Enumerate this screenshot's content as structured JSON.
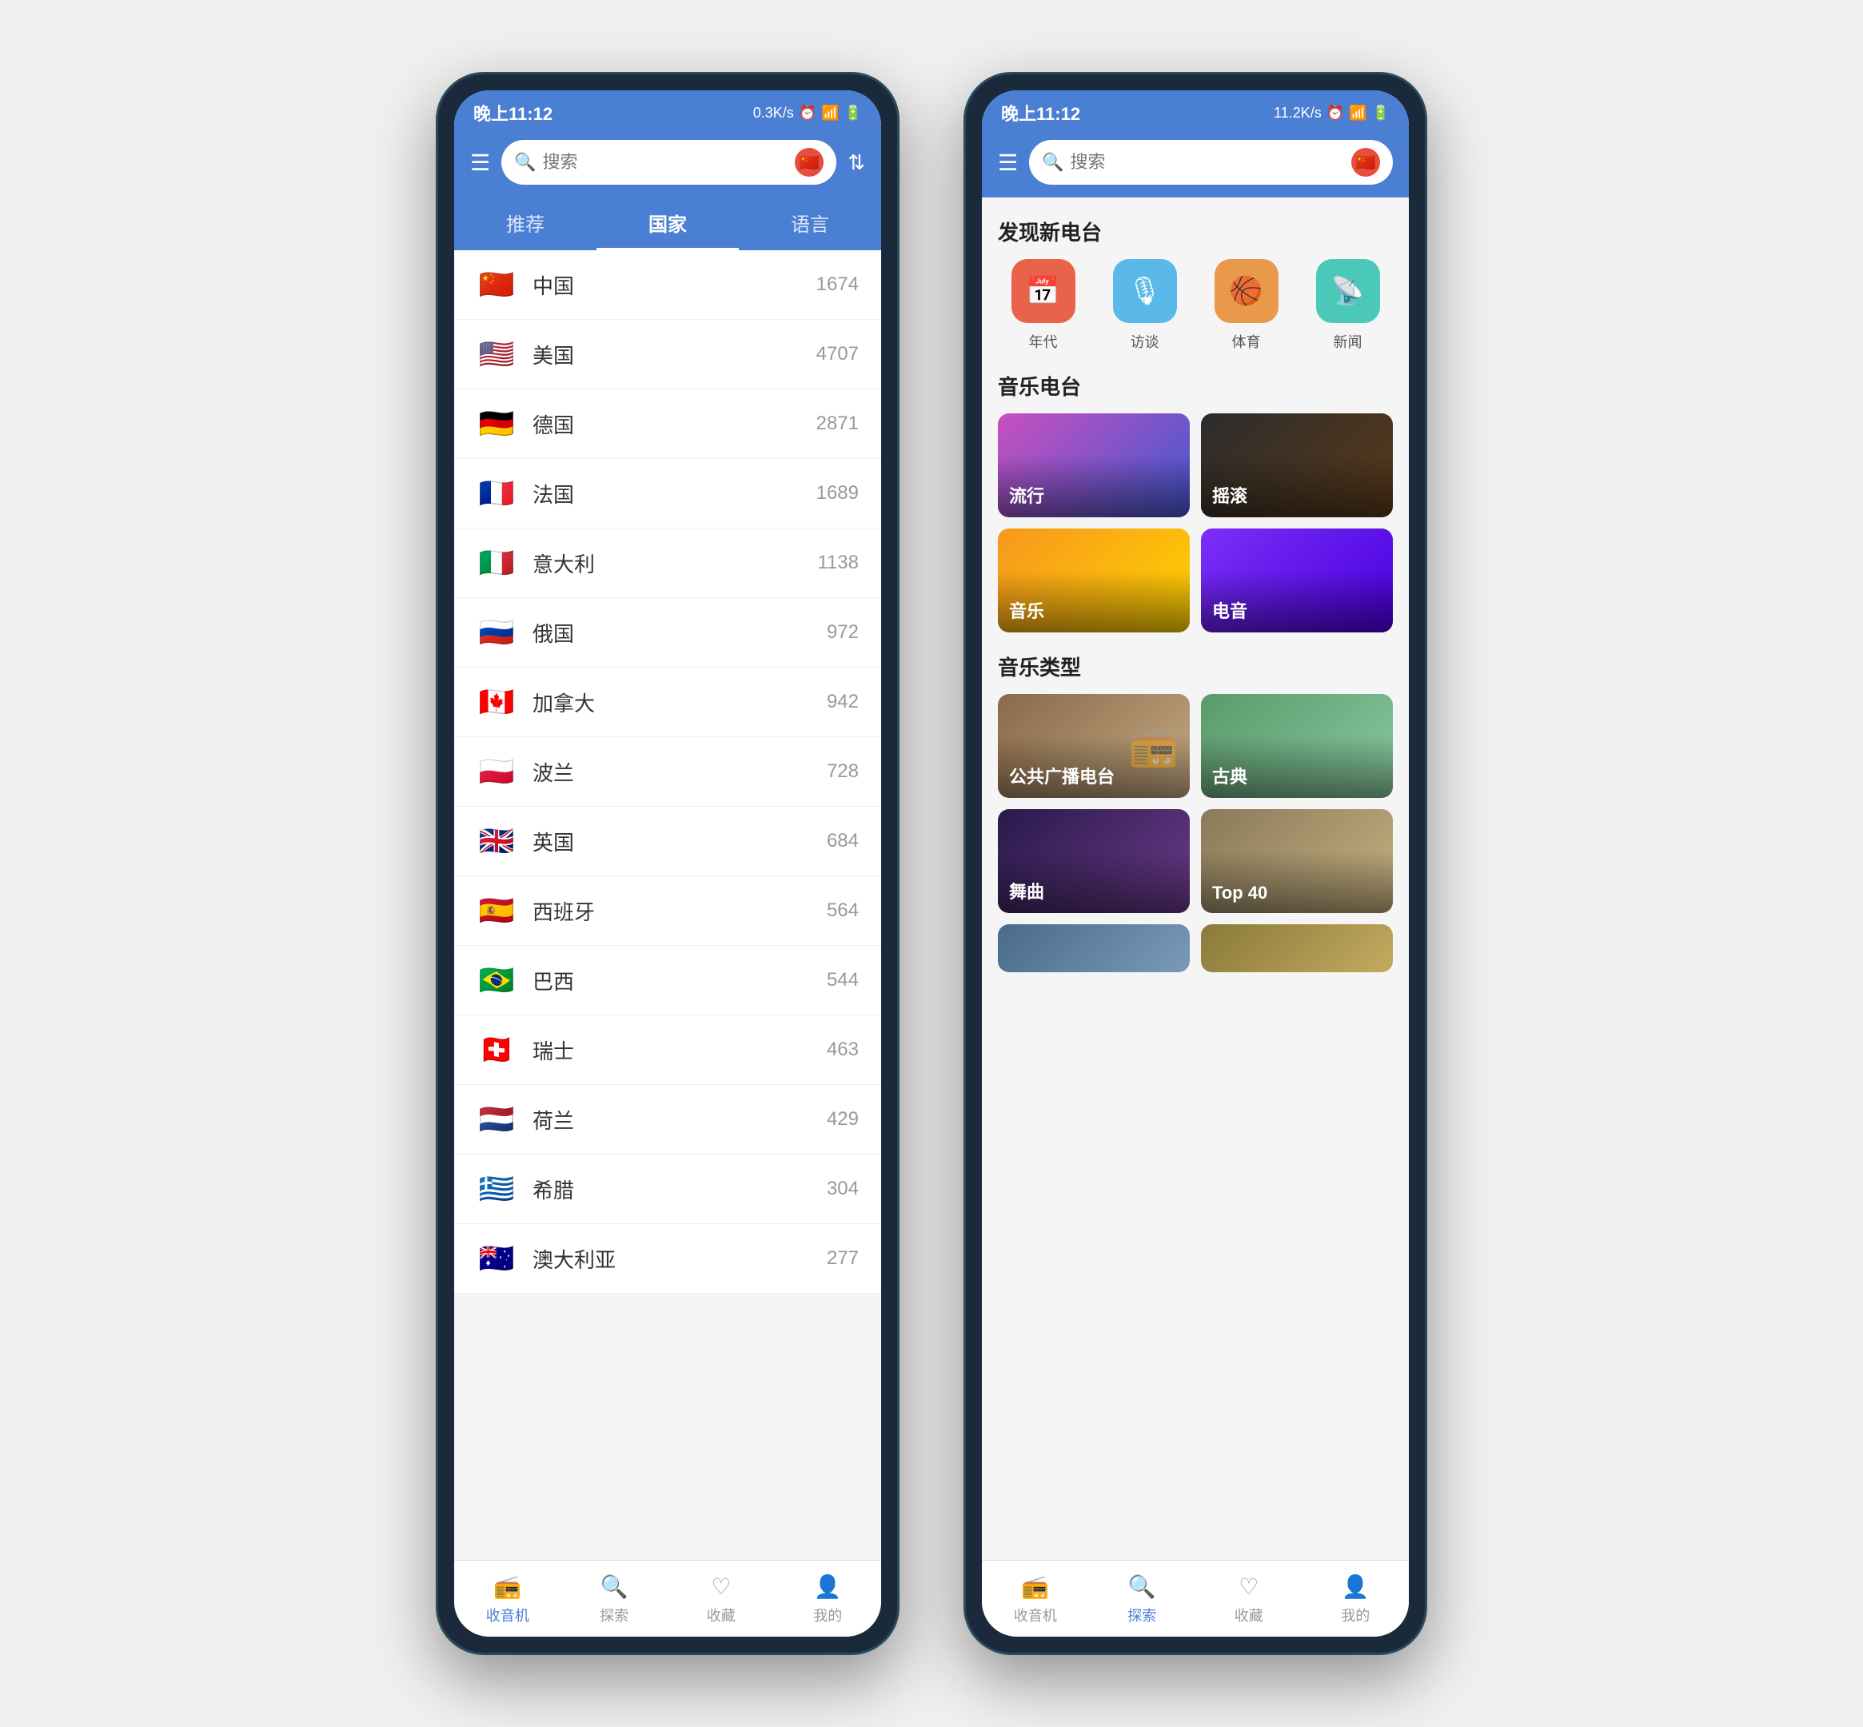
{
  "left_phone": {
    "status_bar": {
      "time": "晚上11:12",
      "signal": "0.3K/s",
      "icons": "📶📶🔕⏰"
    },
    "header": {
      "search_placeholder": "搜索",
      "filter_label": "筛选"
    },
    "tabs": [
      {
        "label": "推荐",
        "active": false
      },
      {
        "label": "国家",
        "active": true
      },
      {
        "label": "语言",
        "active": false
      }
    ],
    "countries": [
      {
        "flag": "🇨🇳",
        "name": "中国",
        "count": "1674"
      },
      {
        "flag": "🇺🇸",
        "name": "美国",
        "count": "4707"
      },
      {
        "flag": "🇩🇪",
        "name": "德国",
        "count": "2871"
      },
      {
        "flag": "🇫🇷",
        "name": "法国",
        "count": "1689"
      },
      {
        "flag": "🇮🇹",
        "name": "意大利",
        "count": "1138"
      },
      {
        "flag": "🇷🇺",
        "name": "俄国",
        "count": "972"
      },
      {
        "flag": "🇨🇦",
        "name": "加拿大",
        "count": "942"
      },
      {
        "flag": "🇵🇱",
        "name": "波兰",
        "count": "728"
      },
      {
        "flag": "🇬🇧",
        "name": "英国",
        "count": "684"
      },
      {
        "flag": "🇪🇸",
        "name": "西班牙",
        "count": "564"
      },
      {
        "flag": "🇧🇷",
        "name": "巴西",
        "count": "544"
      },
      {
        "flag": "🇨🇭",
        "name": "瑞士",
        "count": "463"
      },
      {
        "flag": "🇳🇱",
        "name": "荷兰",
        "count": "429"
      },
      {
        "flag": "🇬🇷",
        "name": "希腊",
        "count": "304"
      },
      {
        "flag": "🇦🇺",
        "name": "澳大利亚",
        "count": "277"
      }
    ],
    "bottom_nav": [
      {
        "icon": "📻",
        "label": "收音机",
        "active": true
      },
      {
        "icon": "🔍",
        "label": "探索",
        "active": false
      },
      {
        "icon": "♡",
        "label": "收藏",
        "active": false
      },
      {
        "icon": "👤",
        "label": "我的",
        "active": false
      }
    ]
  },
  "right_phone": {
    "status_bar": {
      "time": "晚上11:12",
      "signal": "11.2K/s"
    },
    "header": {
      "search_placeholder": "搜索"
    },
    "sections": {
      "discover": {
        "title": "发现新电台",
        "categories": [
          {
            "label": "年代",
            "icon": "📅",
            "color_class": "cat-era"
          },
          {
            "label": "访谈",
            "icon": "🎙",
            "color_class": "cat-interview"
          },
          {
            "label": "体育",
            "icon": "🏀",
            "color_class": "cat-sports"
          },
          {
            "label": "新闻",
            "icon": "📡",
            "color_class": "cat-news"
          }
        ]
      },
      "music_radio": {
        "title": "音乐电台",
        "items": [
          {
            "label": "流行",
            "bg_class": "bg-pop"
          },
          {
            "label": "摇滚",
            "bg_class": "bg-rock"
          },
          {
            "label": "音乐",
            "bg_class": "bg-music"
          },
          {
            "label": "电音",
            "bg_class": "bg-electronic"
          }
        ]
      },
      "music_type": {
        "title": "音乐类型",
        "items": [
          {
            "label": "公共广播电台",
            "bg_class": "bg-public"
          },
          {
            "label": "古典",
            "bg_class": "bg-classical"
          },
          {
            "label": "舞曲",
            "bg_class": "bg-dance"
          },
          {
            "label": "Top 40",
            "bg_class": "bg-top40"
          }
        ]
      }
    },
    "bottom_nav": [
      {
        "icon": "📻",
        "label": "收音机",
        "active": false
      },
      {
        "icon": "🔍",
        "label": "探索",
        "active": true
      },
      {
        "icon": "♡",
        "label": "收藏",
        "active": false
      },
      {
        "icon": "👤",
        "label": "我的",
        "active": false
      }
    ]
  }
}
